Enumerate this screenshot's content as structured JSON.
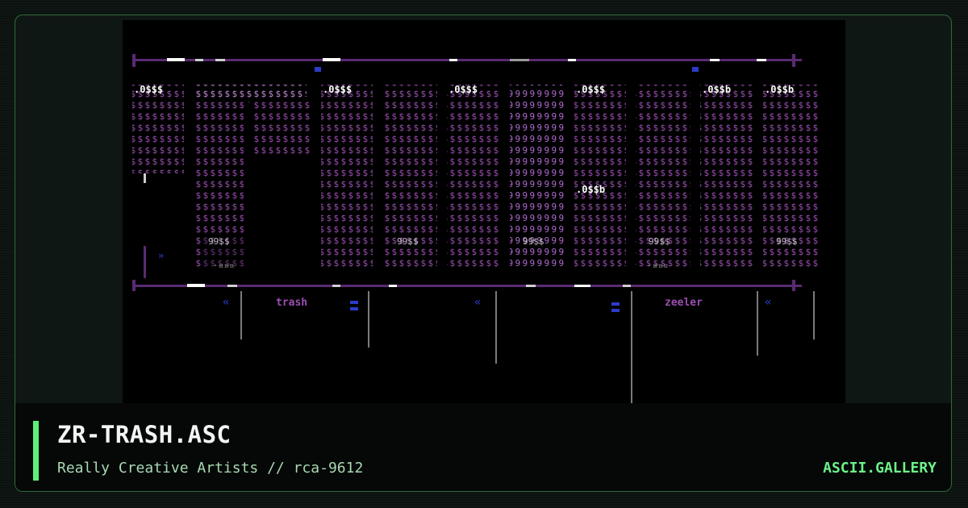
{
  "artwork": {
    "name": "ZR-TRASH.ASC",
    "group": "Really Creative Artists // rca-9612",
    "logo_word": "trash",
    "tag_left": "trash",
    "tag_right": "zeeler"
  },
  "site": {
    "brand": "ASCII.GALLERY"
  },
  "colors": {
    "accent": "#5cf07a",
    "border": "#2f6b3a",
    "art_purple": "#9a4fb0",
    "art_magenta": "#c46be0",
    "art_white": "#ffffff",
    "art_grey": "#9a9a9a",
    "art_blue": "#2c3cc8"
  }
}
